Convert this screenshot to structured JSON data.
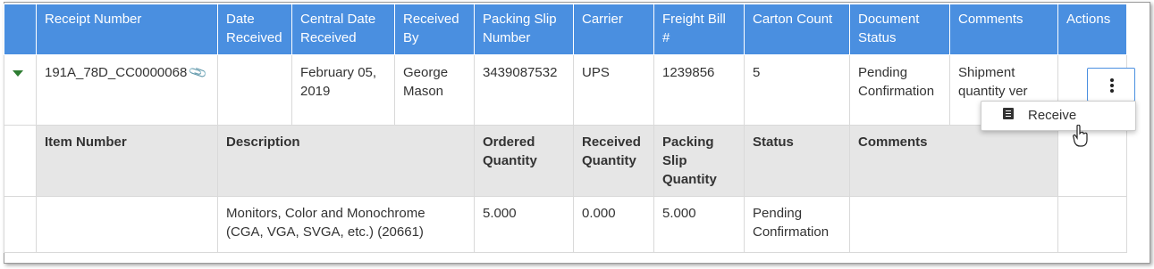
{
  "columns": {
    "receipt_number": "Receipt Number",
    "date_received": "Date Received",
    "central_date_received": "Central Date Received",
    "received_by": "Received By",
    "packing_slip_number": "Packing Slip Number",
    "carrier": "Carrier",
    "freight_bill": "Freight Bill #",
    "carton_count": "Carton Count",
    "document_status": "Document Status",
    "comments": "Comments",
    "actions": "Actions"
  },
  "receipt": {
    "receipt_number": "191A_78D_CC0000068",
    "date_received": "",
    "central_date_received": "February 05, 2019",
    "received_by": "George Mason",
    "packing_slip_number": "3439087532",
    "carrier": "UPS",
    "freight_bill": "1239856",
    "carton_count": "5",
    "document_status": "Pending Confirmation",
    "comments": "Shipment quantity ver"
  },
  "detail_columns": {
    "item_number": "Item Number",
    "description": "Description",
    "ordered_quantity": "Ordered Quantity",
    "received_quantity": "Received Quantity",
    "packing_slip_quantity": "Packing Slip Quantity",
    "status": "Status",
    "comments": "Comments"
  },
  "detail_row": {
    "item_number": "",
    "description": "Monitors, Color and Monochrome (CGA, VGA, SVGA, etc.) (20661)",
    "ordered_quantity": "5.000",
    "received_quantity": "0.000",
    "packing_slip_quantity": "5.000",
    "status": "Pending Confirmation",
    "comments": ""
  },
  "actions_menu": {
    "items": [
      {
        "label": "Receive",
        "icon": "document-icon"
      }
    ]
  },
  "colors": {
    "header_bg": "#4a8fe0",
    "detail_header_bg": "#e6e6e6",
    "expand_arrow": "#2e7d32"
  }
}
